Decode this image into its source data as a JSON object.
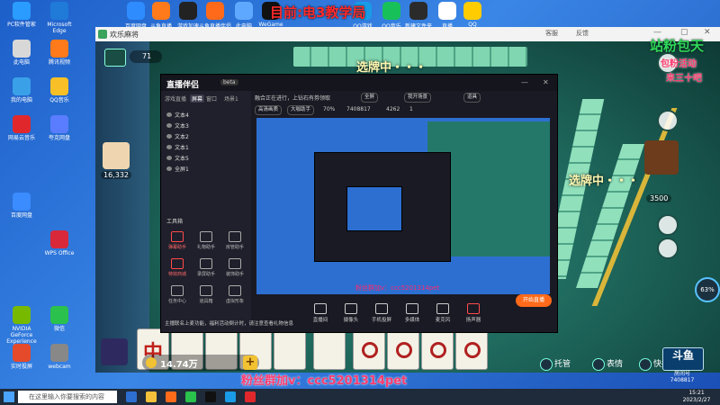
{
  "desktop": {
    "banner": "目前:电3教学局",
    "left_icons": [
      {
        "label": "PC软件管家",
        "color": "#2a9bff"
      },
      {
        "label": "Microsoft Edge",
        "color": "#1f7ad8"
      },
      {
        "label": "此电脑",
        "color": "#d8d8d8"
      },
      {
        "label": "腾讯视频",
        "color": "#ff7a1a"
      },
      {
        "label": "我的电脑",
        "color": "#3aa1e8"
      },
      {
        "label": "QQ音乐",
        "color": "#f8c026"
      },
      {
        "label": "网易云音乐",
        "color": "#e0282c"
      },
      {
        "label": "夸克网盘",
        "color": "#5a7dff"
      },
      {
        "label": "百度网盘",
        "color": "#3a8cff"
      },
      {
        "label": "WPS Office",
        "color": "#d8283a"
      },
      {
        "label": "NVIDIA GeForce Experience",
        "color": "#76b900"
      },
      {
        "label": "微信",
        "color": "#2ac14c"
      },
      {
        "label": "实时投屏",
        "color": "#e54a2a"
      },
      {
        "label": "webcam",
        "color": "#888888"
      }
    ],
    "top_icons": [
      {
        "label": "百度网盘",
        "color": "#2f8cff"
      },
      {
        "label": "斗鱼直播",
        "color": "#ff7a1a"
      },
      {
        "label": "游戏加速",
        "color": "#222222"
      },
      {
        "label": "斗鱼直播伴侣",
        "color": "#ff6a1a"
      },
      {
        "label": "此电脑",
        "color": "#5fa8ff"
      },
      {
        "label": "WeGame",
        "color": "#111111"
      },
      {
        "label": "QQ游戏",
        "color": "#1a9be8"
      },
      {
        "label": "QQ音乐",
        "color": "#18c05a"
      },
      {
        "label": "新建文件夹",
        "color": "#2b2b2b"
      },
      {
        "label": "直播",
        "color": "#ffffff"
      },
      {
        "label": "QQ",
        "color": "#ffcc00"
      }
    ]
  },
  "game": {
    "window_title": "欢乐麻将",
    "title_buttons": [
      "客服",
      "反馈"
    ],
    "coin_top": "71",
    "status_top": "选牌中・・・",
    "status_right": "选牌中・・・",
    "score_left": "16,332",
    "score_right": "3500",
    "coins": "14.74万",
    "actions": [
      "托管",
      "表情",
      "快捷语"
    ],
    "promo_right": "站粉包天",
    "promo_right2": "包粉活动",
    "promo_right3": "来三十吧",
    "promo_bottom": "粉丝群加v：ccc5201314pet",
    "logo_title": "斗鱼",
    "logo_sub": "房间号",
    "room_id": "7408817",
    "percent": "63%",
    "hand_tiles": [
      "中",
      "",
      "",
      "",
      "",
      "",
      "",
      "",
      "",
      ""
    ]
  },
  "broadcaster": {
    "app_name": "直播伴侣",
    "version": "beta",
    "tabs": [
      "游戏直播",
      "屏幕",
      "窗口",
      "场景1"
    ],
    "layers": [
      "文本4",
      "文本3",
      "文本2",
      "文本1",
      "文本5",
      "全屏1"
    ],
    "toolbox_title": "工具箱",
    "tools": [
      "弹幕助手",
      "礼物助手",
      "房管助手",
      "特效商城",
      "录屏助手",
      "装饰助手",
      "任务中心",
      "道具箱",
      "虚拟形象"
    ],
    "topbar_text": "融合正在进行，上钻石有券领取",
    "pills": [
      "全屏",
      "我开场景",
      "道具"
    ],
    "topbar2": [
      "高清画质",
      "大咖助手",
      "70%",
      "7408817",
      "4262",
      "1"
    ],
    "preview_red_text": "粉丝群加v：ccc5201314pet",
    "bottom_tools": [
      "直播间",
      "摄像头",
      "手机投屏",
      "多媒体",
      "麦克风",
      "扬声器"
    ],
    "live_button": "开始直播",
    "notice": "主播联名上麦功能，福利活动倒计时，请注意查看礼物信息"
  },
  "taskbar": {
    "search_placeholder": "在这里输入你要搜索的内容",
    "time": "15:21",
    "date": "2023/2/27"
  }
}
